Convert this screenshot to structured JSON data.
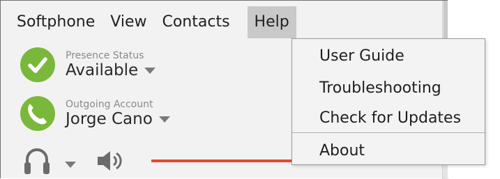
{
  "menubar": {
    "items": [
      {
        "label": "Softphone"
      },
      {
        "label": "View"
      },
      {
        "label": "Contacts"
      },
      {
        "label": "Help",
        "active": true
      }
    ]
  },
  "presence": {
    "label": "Presence Status",
    "value": "Available",
    "icon": "check-icon",
    "color": "#7ab83b"
  },
  "account": {
    "label": "Outgoing Account",
    "value": "Jorge Cano",
    "icon": "phone-transfer-icon",
    "color": "#7ab83b"
  },
  "audio": {
    "device_icon": "headset-icon",
    "volume_icon": "speaker-icon",
    "volume_color": "#e8482c"
  },
  "help_menu": {
    "items": [
      {
        "label": "User Guide"
      },
      {
        "label": "Troubleshooting"
      },
      {
        "label": "Check for Updates"
      },
      {
        "label": "About"
      }
    ]
  }
}
